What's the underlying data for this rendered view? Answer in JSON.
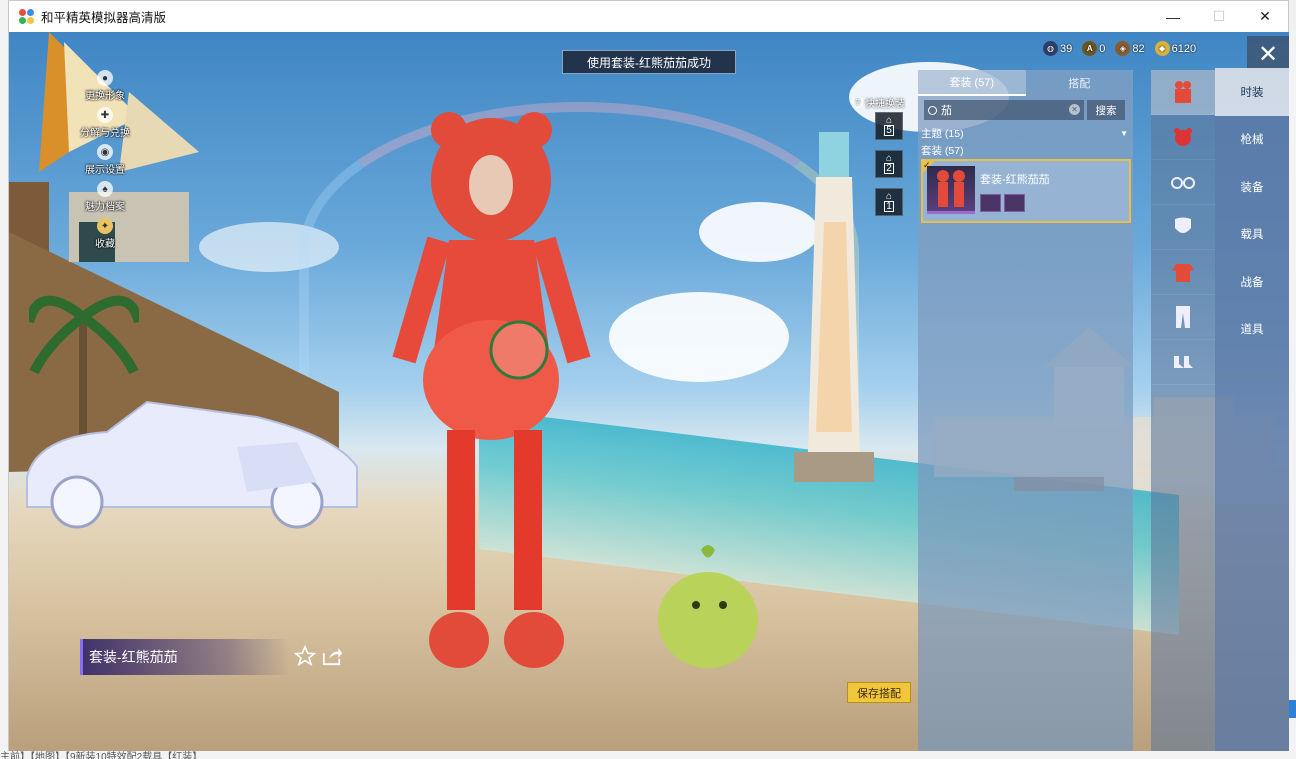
{
  "window": {
    "title": "和平精英模拟器高清版",
    "controls": {
      "minimize": "—",
      "maximize": "☐",
      "close": "✕"
    }
  },
  "toast": "使用套装-红熊茄茄成功",
  "left_menu": [
    {
      "label": "更换形象",
      "icon": "avatar-icon"
    },
    {
      "label": "分解与兑换",
      "icon": "decompose-icon"
    },
    {
      "label": "展示设置",
      "icon": "eye-icon"
    },
    {
      "label": "魅力档案",
      "icon": "charm-icon"
    },
    {
      "label": "收藏",
      "icon": "collection-icon"
    }
  ],
  "quick_swap": {
    "label": "快捷换装",
    "help": "?",
    "slots": [
      "5",
      "2",
      "1"
    ]
  },
  "currencies": [
    {
      "name": "globe-coin-icon",
      "value": "39",
      "color": "#2f3f6a"
    },
    {
      "name": "a-coin-icon",
      "value": "0",
      "color": "#6b5520"
    },
    {
      "name": "bronze-coin-icon",
      "value": "82",
      "color": "#8a5a30"
    },
    {
      "name": "gold-coin-icon",
      "value": "6120",
      "color": "#d9b23a"
    }
  ],
  "wardrobe": {
    "tabs": [
      {
        "label": "套装 (57)",
        "active": true
      },
      {
        "label": "搭配",
        "active": false
      }
    ],
    "search": {
      "value": "茄",
      "button": "搜索"
    },
    "filter": {
      "label": "主题 (15)",
      "arrow": "▼"
    },
    "section": "套装 (57)",
    "items": [
      {
        "title": "套装-红熊茄茄",
        "equipped": true
      }
    ]
  },
  "categories": [
    "outfit-icon",
    "headgear-icon",
    "glasses-icon",
    "mask-icon",
    "top-icon",
    "pants-icon",
    "shoes-icon"
  ],
  "right_nav": [
    {
      "label": "时装",
      "active": true
    },
    {
      "label": "枪械",
      "active": false
    },
    {
      "label": "装备",
      "active": false
    },
    {
      "label": "载具",
      "active": false
    },
    {
      "label": "战备",
      "active": false
    },
    {
      "label": "道具",
      "active": false
    }
  ],
  "outfit_name": "套装-红熊茄茄",
  "save_button": "保存搭配",
  "host": {
    "bottom_text": "主前】【地图】【9新装10特效配2载具【红装】"
  },
  "colors": {
    "accent": "#f2c63a",
    "panel": "#5a78a5",
    "toast_bg": "#1c283a",
    "name_bar": "#8a6bff"
  }
}
